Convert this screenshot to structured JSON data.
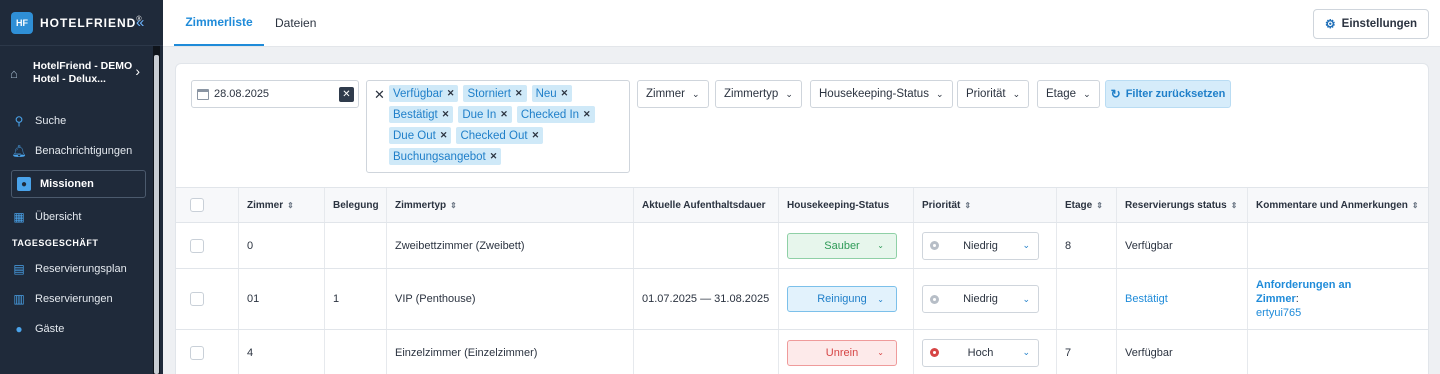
{
  "sidebar": {
    "brand": "HOTELFRIEND",
    "hotel_name": "HotelFriend - DEMO Hotel - Delux...",
    "items": [
      {
        "label": "Suche",
        "icon": "search-icon"
      },
      {
        "label": "Benachrichtigungen",
        "icon": "bell-icon"
      },
      {
        "label": "Missionen",
        "icon": "user-icon"
      },
      {
        "label": "Übersicht",
        "icon": "grid-icon"
      }
    ],
    "section": "TAGESGESCHÄFT",
    "section_items": [
      {
        "label": "Reservierungsplan",
        "icon": "calendar-icon"
      },
      {
        "label": "Reservierungen",
        "icon": "document-icon"
      },
      {
        "label": "Gäste",
        "icon": "person-icon"
      }
    ]
  },
  "tabs": [
    {
      "label": "Zimmerliste",
      "active": true
    },
    {
      "label": "Dateien",
      "active": false
    }
  ],
  "settings_label": "Einstellungen",
  "filters": {
    "date": "28.08.2025",
    "chips": [
      "Verfügbar",
      "Storniert",
      "Neu",
      "Bestätigt",
      "Due In",
      "Checked In",
      "Due Out",
      "Checked Out",
      "Buchungsangebot"
    ],
    "dropdowns": [
      "Zimmer",
      "Zimmertyp",
      "Housekeeping-Status",
      "Priorität",
      "Etage"
    ],
    "reset_label": "Filter zurücksetzen"
  },
  "table": {
    "headers": [
      "Zimmer",
      "Belegung",
      "Zimmertyp",
      "Aktuelle Aufenthaltsdauer",
      "Housekeeping-Status",
      "Priorität",
      "Etage",
      "Reservierungs status",
      "Kommentare und Anmerkungen"
    ],
    "rows": [
      {
        "zimmer": "0",
        "belegung": "",
        "typ": "Zweibettzimmer (Zweibett)",
        "dauer": "",
        "hk": "Sauber",
        "hk_color": "#2e9a57",
        "prio": "Niedrig",
        "etage": "8",
        "status": "Verfügbar",
        "comment_title": "",
        "comment_text": ""
      },
      {
        "zimmer": "01",
        "belegung": "1",
        "typ": "VIP (Penthouse)",
        "dauer": "01.07.2025 — 31.08.2025",
        "hk": "Reinigung",
        "hk_color": "#1f7fc9",
        "prio": "Niedrig",
        "etage": "",
        "status": "Bestätigt",
        "comment_title": "Anforderungen an Zimmer",
        "comment_text": "ertyui765"
      },
      {
        "zimmer": "4",
        "belegung": "",
        "typ": "Einzelzimmer (Einzelzimmer)",
        "dauer": "",
        "hk": "Unrein",
        "hk_color": "#d64545",
        "prio": "Hoch",
        "etage": "7",
        "status": "Verfügbar",
        "comment_title": "",
        "comment_text": ""
      }
    ]
  }
}
